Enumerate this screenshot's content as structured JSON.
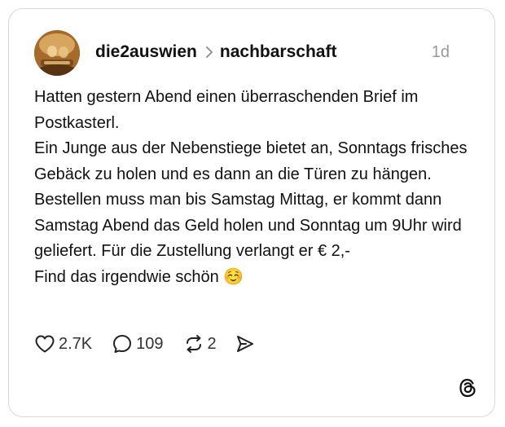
{
  "post": {
    "author": "die2auswien",
    "community": "nachbarschaft",
    "timestamp": "1d",
    "lines": [
      "Hatten gestern Abend einen überraschenden Brief im Postkasterl.",
      "Ein Junge aus der Nebenstiege bietet an, Sonntags frisches Gebäck zu holen und es dann an die Türen zu hängen. Bestellen muss man bis Samstag Mittag, er kommt dann Samstag Abend das Geld holen und Sonntag um 9Uhr wird geliefert. Für die Zustellung verlangt er € 2,-",
      "Find das irgendwie schön ☺️"
    ]
  },
  "actions": {
    "likes": "2.7K",
    "replies": "109",
    "reposts": "2"
  },
  "icons": {
    "separator": "chevron-right-icon",
    "like": "heart-icon",
    "reply": "speech-bubble-icon",
    "repost": "repost-icon",
    "share": "send-icon",
    "brand": "threads-logo-icon"
  },
  "colors": {
    "text": "#111111",
    "muted": "#999999",
    "border": "#d9d9d9"
  }
}
